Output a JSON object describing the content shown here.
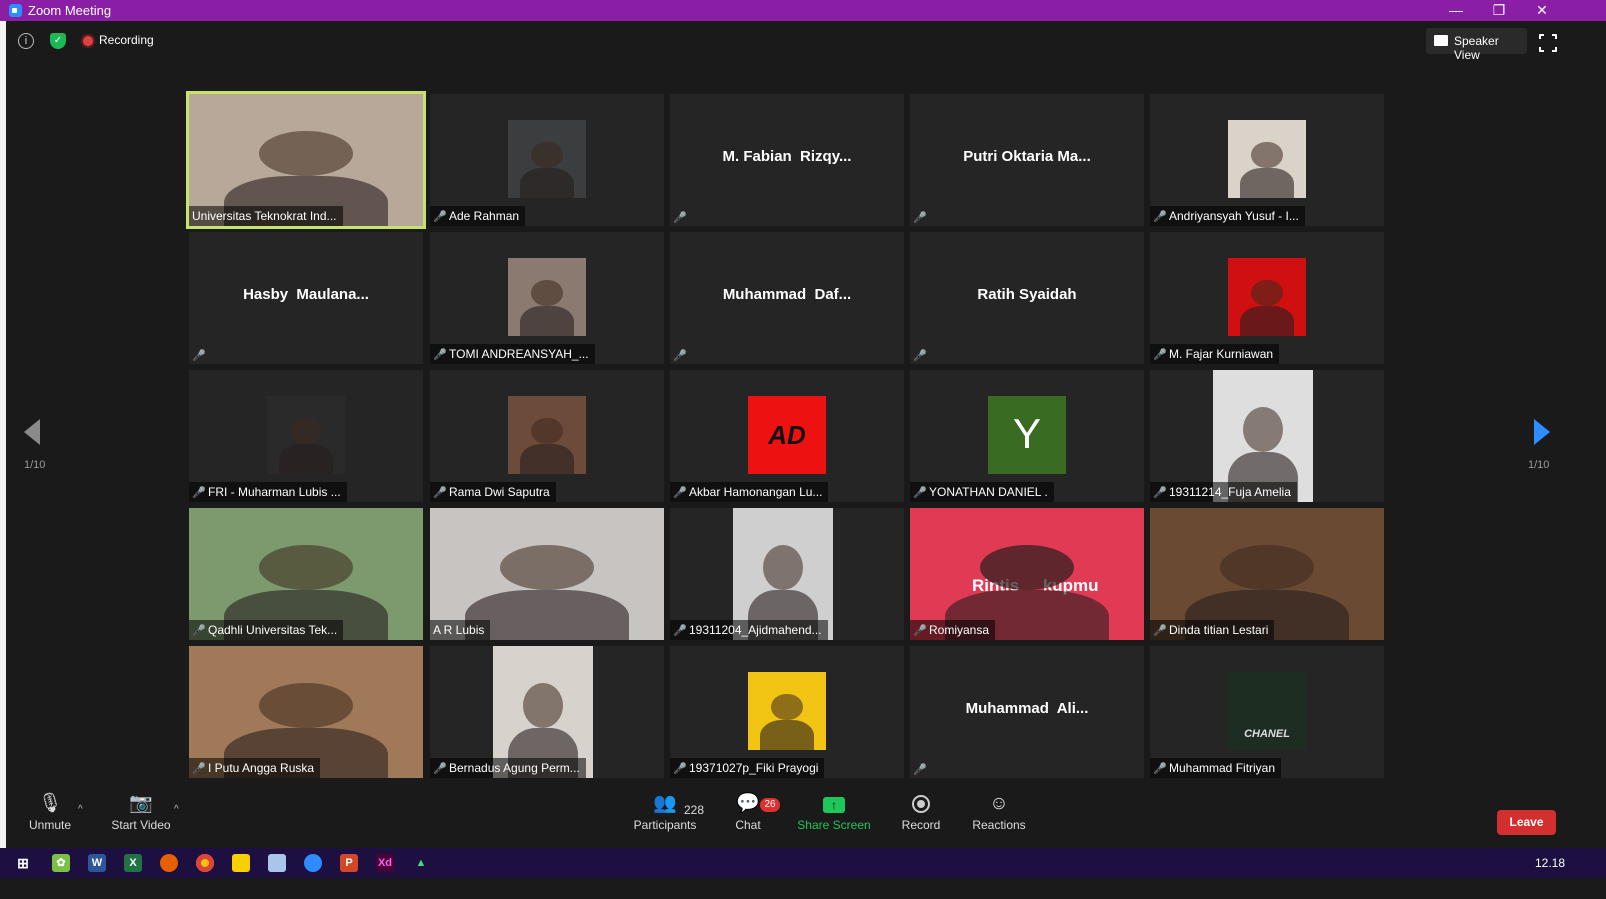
{
  "window": {
    "title": "Zoom Meeting",
    "controls": [
      "—",
      "❐",
      "✕"
    ]
  },
  "topbar": {
    "recording_label": "Recording",
    "view_label": "Speaker View"
  },
  "pager": {
    "left": "1/10",
    "right": "1/10"
  },
  "colors": {
    "title_bar": "#8a1fa6",
    "active_speaker": "#c7e36b",
    "muted_mic": "#e23b3b",
    "share_green": "#1fc65a",
    "leave_red": "#d32f2f",
    "accent_blue": "#2d8cff"
  },
  "tiles": [
    {
      "name": "Universitas Teknokrat Ind...",
      "kind": "full",
      "bg": "#b8a89a",
      "active": true,
      "muted": false
    },
    {
      "name": "Ade Rahman",
      "kind": "small",
      "bg": "#3b3d3e",
      "muted": true
    },
    {
      "name": "M. Fabian  Rizqy...",
      "kind": "name",
      "muted": true
    },
    {
      "name": "Putri Oktaria Ma...",
      "kind": "name",
      "muted": true
    },
    {
      "name": "Andriyansyah Yusuf - I...",
      "kind": "small",
      "bg": "#d9d3c9",
      "muted": true
    },
    {
      "name": "Hasby  Maulana...",
      "kind": "name",
      "muted": true
    },
    {
      "name": "TOMI ANDREANSYAH_...",
      "kind": "small",
      "bg": "#8a7a70",
      "muted": true
    },
    {
      "name": "Muhammad  Daf...",
      "kind": "name",
      "muted": true
    },
    {
      "name": "Ratih Syaidah",
      "kind": "name",
      "muted": true
    },
    {
      "name": "M. Fajar Kurniawan",
      "kind": "small",
      "bg": "#d01010",
      "muted": true
    },
    {
      "name": "FRI - Muharman Lubis ...",
      "kind": "small",
      "bg": "#2a2a2a",
      "muted": true
    },
    {
      "name": "Rama Dwi Saputra",
      "kind": "small",
      "bg": "#6d4b3a",
      "muted": true
    },
    {
      "name": "Akbar Hamonangan Lu...",
      "kind": "logo",
      "bg": "#ee1111",
      "logo": "AD",
      "muted": true
    },
    {
      "name": "YONATHAN DANIEL .",
      "kind": "letter",
      "bg": "#3a6b22",
      "letter": "Y",
      "muted": true
    },
    {
      "name": "19311214_Fuja Amelia",
      "kind": "tall",
      "bg": "#dedede",
      "muted": true
    },
    {
      "name": "Qadhli Universitas Tek...",
      "kind": "full",
      "bg": "#7c9a6e",
      "muted": true
    },
    {
      "name": "A R Lubis",
      "kind": "full",
      "bg": "#c8c4c2",
      "muted": false
    },
    {
      "name": "19311204_Ajidmahend...",
      "kind": "tall",
      "bg": "#cfcfcf",
      "muted": true
    },
    {
      "name": "Romiyansa",
      "kind": "banner",
      "bg": "#e03a55",
      "banner": "Rintis     kupmu",
      "muted": true
    },
    {
      "name": "Dinda titian Lestari",
      "kind": "full",
      "bg": "#6a4a33",
      "muted": true
    },
    {
      "name": "I Putu Angga Ruska",
      "kind": "full",
      "bg": "#a07a58",
      "muted": true
    },
    {
      "name": "Bernadus Agung Perm...",
      "kind": "tall",
      "bg": "#d8d2cc",
      "muted": true
    },
    {
      "name": "19371027p_Fiki Prayogi",
      "kind": "small",
      "bg": "#f2c413",
      "muted": true
    },
    {
      "name": "Muhammad  Ali...",
      "kind": "name",
      "muted": true
    },
    {
      "name": "Muhammad Fitriyan",
      "kind": "logo",
      "bg": "#1d2d22",
      "logo": "CHANEL",
      "muted": true
    }
  ],
  "toolbar": {
    "unmute": "Unmute",
    "start_video": "Start Video",
    "participants": "Participants",
    "participants_count": "228",
    "chat": "Chat",
    "chat_badge": "26",
    "share_screen": "Share Screen",
    "record": "Record",
    "reactions": "Reactions",
    "leave": "Leave"
  },
  "taskbar": {
    "clock": "12.18",
    "apps": [
      "start-icon",
      "clover-app-icon",
      "word-icon",
      "excel-icon",
      "firefox-icon",
      "chrome-icon",
      "sticky-notes-icon",
      "notepad-icon",
      "zoom-icon",
      "powerpoint-icon",
      "xd-icon",
      "android-studio-icon"
    ]
  }
}
